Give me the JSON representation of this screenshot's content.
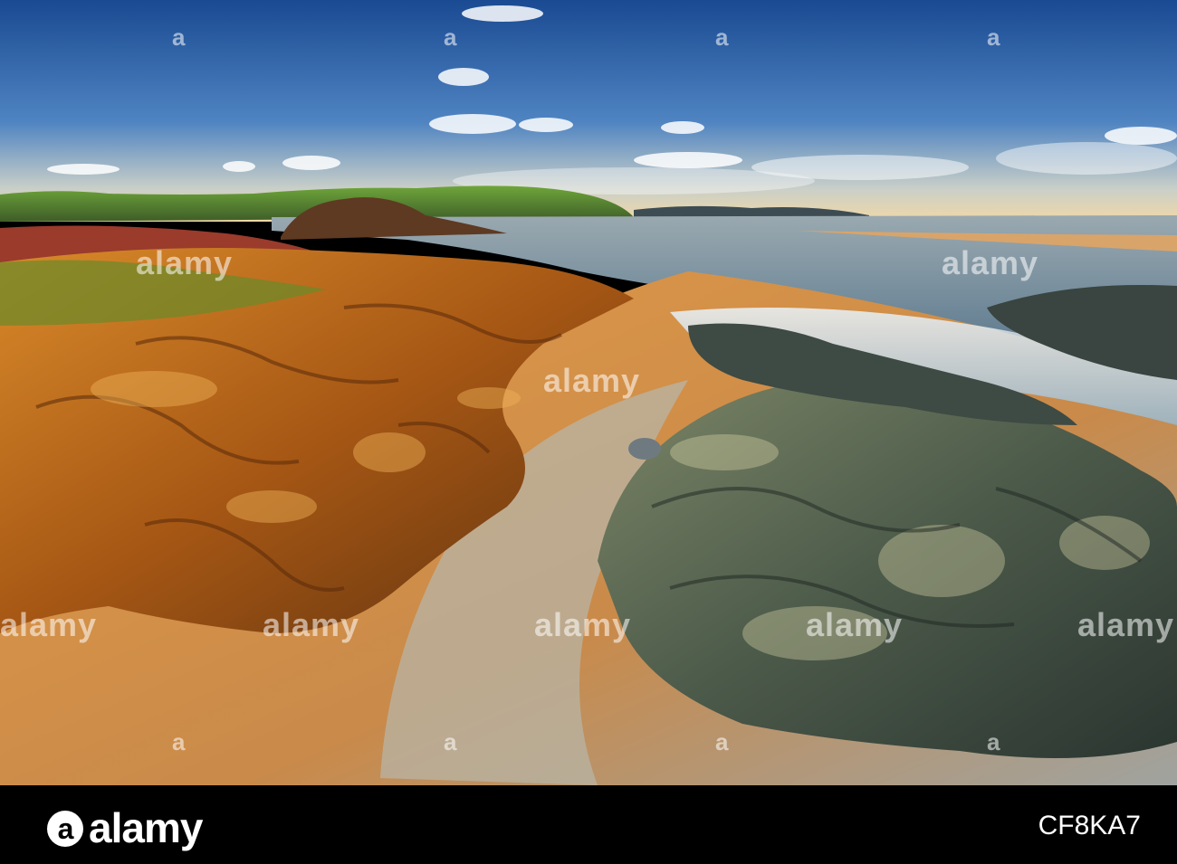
{
  "watermark": {
    "logo_letter": "a",
    "text": "alamy"
  },
  "footer": {
    "brand_letter": "a",
    "brand": "alamy",
    "image_id": "CF8KA7"
  },
  "colors": {
    "sky_top": "#1d4f96",
    "sky_horizon": "#f2dcb0",
    "sea": "#6f8fa6",
    "sand": "#d8893a",
    "rock_warm": "#b5611b",
    "rock_cool": "#4a5a4c",
    "footer_bg": "#000000"
  }
}
